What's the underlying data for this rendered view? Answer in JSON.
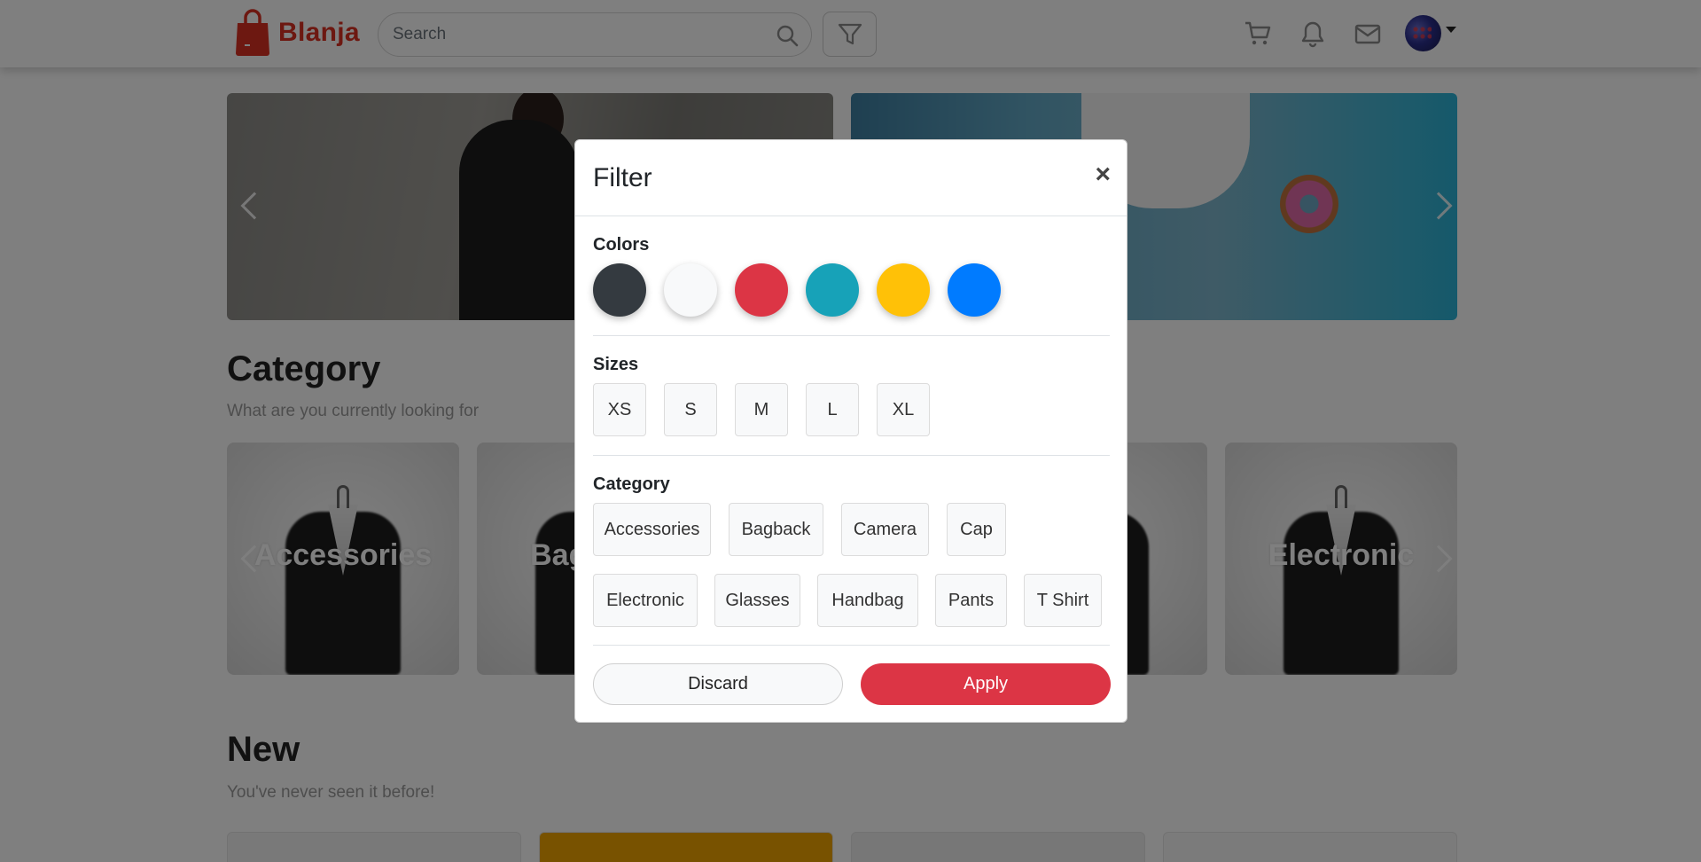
{
  "navbar": {
    "brand": "Blanja",
    "search_placeholder": "Search",
    "icons": [
      "search-icon",
      "filter-icon",
      "cart-icon",
      "bell-icon",
      "mail-icon"
    ]
  },
  "sections": {
    "category_title": "Category",
    "category_subtitle": "What are you currently looking for",
    "new_title": "New",
    "new_subtitle": "You've never seen it before!"
  },
  "category_cards": [
    "Accessories",
    "Bagback",
    "Electronic"
  ],
  "modal": {
    "title": "Filter",
    "close_symbol": "×",
    "colors_label": "Colors",
    "colors": [
      "#343a40",
      "#f8f9fa",
      "#dc3545",
      "#17a2b8",
      "#ffc107",
      "#007bff"
    ],
    "sizes_label": "Sizes",
    "sizes": [
      "XS",
      "S",
      "M",
      "L",
      "XL"
    ],
    "category_label": "Category",
    "categories": [
      "Accessories",
      "Bagback",
      "Camera",
      "Cap",
      "Electronic",
      "Glasses",
      "Handbag",
      "Pants",
      "T Shirt"
    ],
    "discard_label": "Discard",
    "apply_label": "Apply"
  },
  "theme": {
    "brand_color": "#db3022",
    "apply_color": "#dc3545"
  }
}
